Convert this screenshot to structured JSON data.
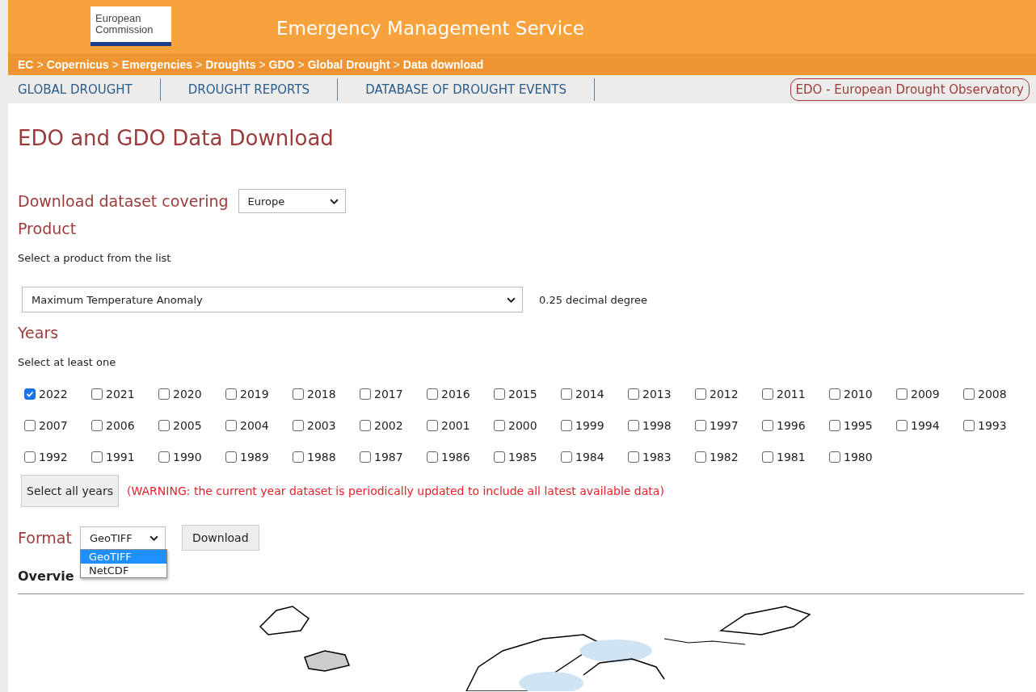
{
  "header": {
    "logo_text": "European Commission",
    "title": "Emergency Management Service"
  },
  "breadcrumb": [
    "EC",
    "Copernicus",
    "Emergencies",
    "Droughts",
    "GDO",
    "Global Drought",
    "Data download"
  ],
  "breadcrumb_separator": ">",
  "nav": [
    {
      "label": "GLOBAL DROUGHT"
    },
    {
      "label": "DROUGHT REPORTS"
    },
    {
      "label": "DATABASE OF DROUGHT EVENTS"
    }
  ],
  "nav_badge": "EDO - European Drought Observatory",
  "page_title": "EDO and GDO Data Download",
  "coverage": {
    "label": "Download dataset covering",
    "value": "Europe"
  },
  "product": {
    "heading": "Product",
    "hint": "Select a product from the list",
    "value": "Maximum Temperature Anomaly",
    "resolution": "0.25 decimal degree"
  },
  "years": {
    "heading": "Years",
    "hint": "Select at least one",
    "items": [
      {
        "label": "2022",
        "checked": true
      },
      {
        "label": "2021",
        "checked": false
      },
      {
        "label": "2020",
        "checked": false
      },
      {
        "label": "2019",
        "checked": false
      },
      {
        "label": "2018",
        "checked": false
      },
      {
        "label": "2017",
        "checked": false
      },
      {
        "label": "2016",
        "checked": false
      },
      {
        "label": "2015",
        "checked": false
      },
      {
        "label": "2014",
        "checked": false
      },
      {
        "label": "2013",
        "checked": false
      },
      {
        "label": "2012",
        "checked": false
      },
      {
        "label": "2011",
        "checked": false
      },
      {
        "label": "2010",
        "checked": false
      },
      {
        "label": "2009",
        "checked": false
      },
      {
        "label": "2008",
        "checked": false
      },
      {
        "label": "2007",
        "checked": false
      },
      {
        "label": "2006",
        "checked": false
      },
      {
        "label": "2005",
        "checked": false
      },
      {
        "label": "2004",
        "checked": false
      },
      {
        "label": "2003",
        "checked": false
      },
      {
        "label": "2002",
        "checked": false
      },
      {
        "label": "2001",
        "checked": false
      },
      {
        "label": "2000",
        "checked": false
      },
      {
        "label": "1999",
        "checked": false
      },
      {
        "label": "1998",
        "checked": false
      },
      {
        "label": "1997",
        "checked": false
      },
      {
        "label": "1996",
        "checked": false
      },
      {
        "label": "1995",
        "checked": false
      },
      {
        "label": "1994",
        "checked": false
      },
      {
        "label": "1993",
        "checked": false
      },
      {
        "label": "1992",
        "checked": false
      },
      {
        "label": "1991",
        "checked": false
      },
      {
        "label": "1990",
        "checked": false
      },
      {
        "label": "1989",
        "checked": false
      },
      {
        "label": "1988",
        "checked": false
      },
      {
        "label": "1987",
        "checked": false
      },
      {
        "label": "1986",
        "checked": false
      },
      {
        "label": "1985",
        "checked": false
      },
      {
        "label": "1984",
        "checked": false
      },
      {
        "label": "1983",
        "checked": false
      },
      {
        "label": "1982",
        "checked": false
      },
      {
        "label": "1981",
        "checked": false
      },
      {
        "label": "1980",
        "checked": false
      }
    ]
  },
  "select_all_button": "Select all years",
  "warning": "(WARNING: the current year dataset is periodically updated to include all latest available data)",
  "format": {
    "label": "Format",
    "value": "GeoTIFF",
    "options": [
      {
        "label": "GeoTIFF",
        "selected": true
      },
      {
        "label": "NetCDF",
        "selected": false
      }
    ]
  },
  "download_button": "Download",
  "overview_heading": "Overvie"
}
